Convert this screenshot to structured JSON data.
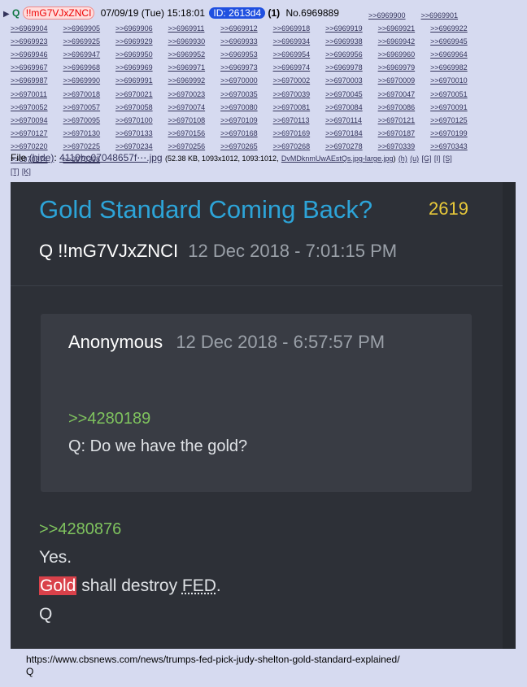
{
  "post": {
    "arrow": "▶",
    "name": "Q",
    "tripcode": "!!mG7VJxZNCI",
    "datetime": "07/09/19 (Tue) 15:18:01",
    "id_label": "ID: 2613d4",
    "id_count": "(1)",
    "post_number": "No.6969889"
  },
  "backlinks": [
    ">>6969900",
    ">>6969901",
    ">>6969904",
    ">>6969905",
    ">>6969906",
    ">>6969911",
    ">>6969912",
    ">>6969918",
    ">>6969919",
    ">>6969921",
    ">>6969922",
    ">>6969923",
    ">>6969925",
    ">>6969929",
    ">>6969930",
    ">>6969933",
    ">>6969934",
    ">>6969938",
    ">>6969942",
    ">>6969945",
    ">>6969946",
    ">>6969947",
    ">>6969950",
    ">>6969952",
    ">>6969953",
    ">>6969954",
    ">>6969956",
    ">>6969960",
    ">>6969964",
    ">>6969967",
    ">>6969968",
    ">>6969969",
    ">>6969971",
    ">>6969973",
    ">>6969974",
    ">>6969978",
    ">>6969979",
    ">>6969982",
    ">>6969987",
    ">>6969990",
    ">>6969991",
    ">>6969992",
    ">>6970000",
    ">>6970002",
    ">>6970003",
    ">>6970009",
    ">>6970010",
    ">>6970011",
    ">>6970018",
    ">>6970021",
    ">>6970023",
    ">>6970035",
    ">>6970039",
    ">>6970045",
    ">>6970047",
    ">>6970051",
    ">>6970052",
    ">>6970057",
    ">>6970058",
    ">>6970074",
    ">>6970080",
    ">>6970081",
    ">>6970084",
    ">>6970086",
    ">>6970091",
    ">>6970094",
    ">>6970095",
    ">>6970100",
    ">>6970108",
    ">>6970109",
    ">>6970113",
    ">>6970114",
    ">>6970121",
    ">>6970125",
    ">>6970127",
    ">>6970130",
    ">>6970133",
    ">>6970156",
    ">>6970168",
    ">>6970169",
    ">>6970184",
    ">>6970187",
    ">>6970199",
    ">>6970220",
    ">>6970225",
    ">>6970234",
    ">>6970256",
    ">>6970265",
    ">>6970268",
    ">>6970278",
    ">>6970339",
    ">>6970343",
    ">>6970374",
    ">>6970398"
  ],
  "file": {
    "label": "File",
    "hide": "(hide)",
    "name": "4110bc07048657f⋯.jpg",
    "meta": "(52.38 KB, 1093x1012, 1093:1012,",
    "orig_name": "DvMDknmUwAEstQs.jpg-large.jpg",
    "close": ")",
    "h": "(h)",
    "u": "(u)",
    "g": "[G]",
    "i": "[I]",
    "s": "[S]",
    "t": "[T]",
    "k": "[K]"
  },
  "image": {
    "title": "Gold Standard Coming Back?",
    "drop_number": "2619",
    "author_name": "Q",
    "author_trip": "!!mG7VJxZNCI",
    "author_date": "12 Dec 2018 - 7:01:15 PM",
    "quote": {
      "name": "Anonymous",
      "date": "12 Dec 2018 - 6:57:57 PM",
      "ref": ">>4280189",
      "text": "Q: Do we have the gold?"
    },
    "reply_ref": ">>4280876",
    "reply_yes": "Yes.",
    "reply_gold": "Gold",
    "reply_mid": " shall destroy ",
    "reply_fed": "FED",
    "reply_end": ".",
    "reply_sign": "Q"
  },
  "body_text": {
    "url": "https://www.cbsnews.com/news/trumps-fed-pick-judy-shelton-gold-standard-explained/",
    "sign": "Q"
  }
}
